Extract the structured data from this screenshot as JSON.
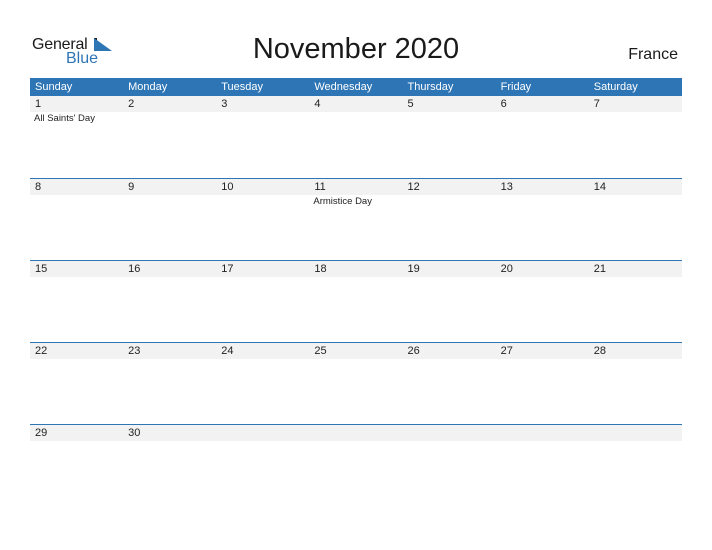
{
  "logo": {
    "line1": "General",
    "line2": "Blue"
  },
  "title": "November 2020",
  "country": "France",
  "colors": {
    "accent": "#2e75b6",
    "strip": "#f2f2f2"
  },
  "weekdays": [
    "Sunday",
    "Monday",
    "Tuesday",
    "Wednesday",
    "Thursday",
    "Friday",
    "Saturday"
  ],
  "weeks": [
    {
      "days": [
        "1",
        "2",
        "3",
        "4",
        "5",
        "6",
        "7"
      ],
      "events": [
        "All Saints' Day",
        "",
        "",
        "",
        "",
        "",
        ""
      ]
    },
    {
      "days": [
        "8",
        "9",
        "10",
        "11",
        "12",
        "13",
        "14"
      ],
      "events": [
        "",
        "",
        "",
        "Armistice Day",
        "",
        "",
        ""
      ]
    },
    {
      "days": [
        "15",
        "16",
        "17",
        "18",
        "19",
        "20",
        "21"
      ],
      "events": [
        "",
        "",
        "",
        "",
        "",
        "",
        ""
      ]
    },
    {
      "days": [
        "22",
        "23",
        "24",
        "25",
        "26",
        "27",
        "28"
      ],
      "events": [
        "",
        "",
        "",
        "",
        "",
        "",
        ""
      ]
    },
    {
      "days": [
        "29",
        "30",
        "",
        "",
        "",
        "",
        ""
      ],
      "events": [
        "",
        "",
        "",
        "",
        "",
        "",
        ""
      ]
    }
  ]
}
